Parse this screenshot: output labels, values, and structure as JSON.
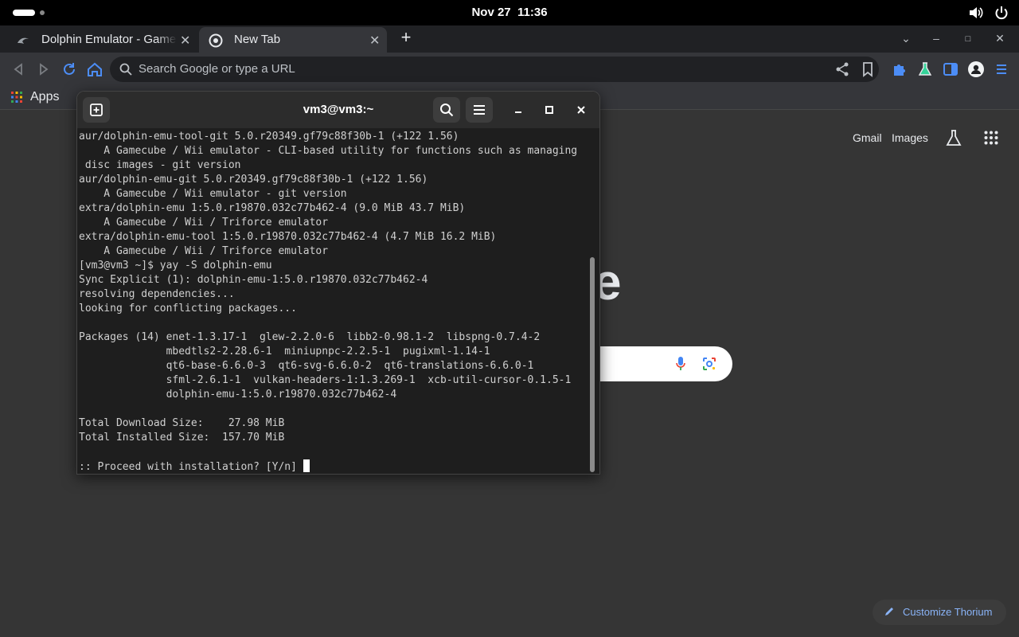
{
  "topbar": {
    "date": "Nov 27",
    "time": "11:36"
  },
  "browser": {
    "tabs": [
      {
        "title": "Dolphin Emulator - GameCube/Wii games on PC",
        "active": false
      },
      {
        "title": "New Tab",
        "active": true
      }
    ],
    "omnibox_placeholder": "Search Google or type a URL",
    "bookmarks": {
      "apps_label": "Apps"
    }
  },
  "ntp": {
    "links": {
      "gmail": "Gmail",
      "images": "Images"
    },
    "logo_fragment": "e",
    "customize_label": "Customize Thorium"
  },
  "terminal": {
    "title": "vm3@vm3:~",
    "lines": [
      "aur/dolphin-emu-tool-git 5.0.r20349.gf79c88f30b-1 (+122 1.56)",
      "    A Gamecube / Wii emulator - CLI-based utility for functions such as managing",
      " disc images - git version",
      "aur/dolphin-emu-git 5.0.r20349.gf79c88f30b-1 (+122 1.56)",
      "    A Gamecube / Wii emulator - git version",
      "extra/dolphin-emu 1:5.0.r19870.032c77b462-4 (9.0 MiB 43.7 MiB)",
      "    A Gamecube / Wii / Triforce emulator",
      "extra/dolphin-emu-tool 1:5.0.r19870.032c77b462-4 (4.7 MiB 16.2 MiB)",
      "    A Gamecube / Wii / Triforce emulator",
      "[vm3@vm3 ~]$ yay -S dolphin-emu",
      "Sync Explicit (1): dolphin-emu-1:5.0.r19870.032c77b462-4",
      "resolving dependencies...",
      "looking for conflicting packages...",
      "",
      "Packages (14) enet-1.3.17-1  glew-2.2.0-6  libb2-0.98.1-2  libspng-0.7.4-2",
      "              mbedtls2-2.28.6-1  miniupnpc-2.2.5-1  pugixml-1.14-1",
      "              qt6-base-6.6.0-3  qt6-svg-6.6.0-2  qt6-translations-6.6.0-1",
      "              sfml-2.6.1-1  vulkan-headers-1:1.3.269-1  xcb-util-cursor-0.1.5-1",
      "              dolphin-emu-1:5.0.r19870.032c77b462-4",
      "",
      "Total Download Size:    27.98 MiB",
      "Total Installed Size:  157.70 MiB",
      ""
    ],
    "prompt": ":: Proceed with installation? [Y/n] "
  },
  "colors": {
    "topbar_bg": "#000000",
    "browser_frame": "#202124",
    "toolbar": "#35363a",
    "terminal_bg": "#1e1e1e",
    "accent_blue": "#8ab4f8"
  }
}
